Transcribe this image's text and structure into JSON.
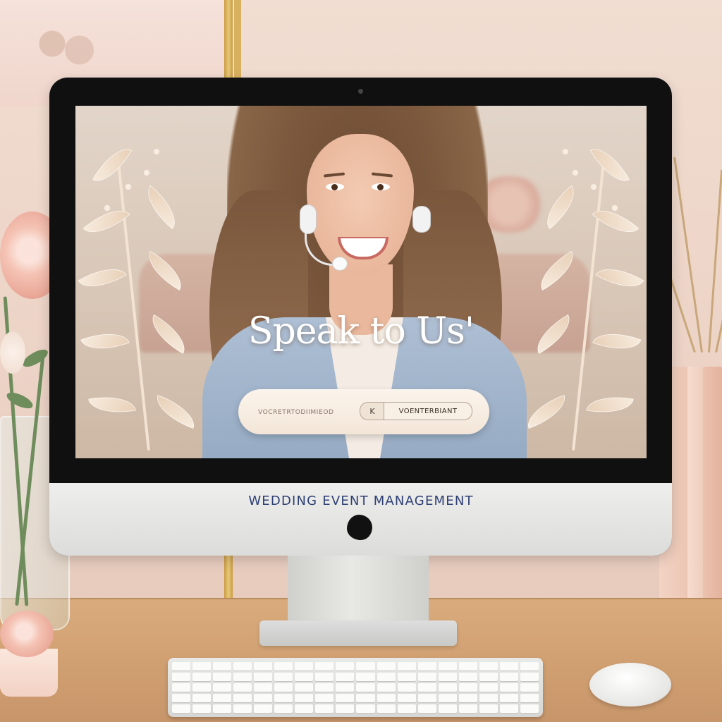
{
  "window": {
    "brand_label": "WEDDING EVENT MANAGEMENT"
  },
  "hero": {
    "heading": "Speak to Us'"
  },
  "contact_form": {
    "input_placeholder": "VOCRETRTODIIMIEOD",
    "key_label": "K",
    "submit_label": "VOENTERBIANT"
  },
  "colors": {
    "brand_text": "#2d3f74",
    "heading": "#ffffff",
    "bezel": "#101010",
    "chin": "#e6e6e4",
    "wall": "#efd9cc",
    "desk": "#d3a474"
  },
  "icons": {
    "logo": "apple-logo-icon",
    "camera": "camera-icon"
  }
}
